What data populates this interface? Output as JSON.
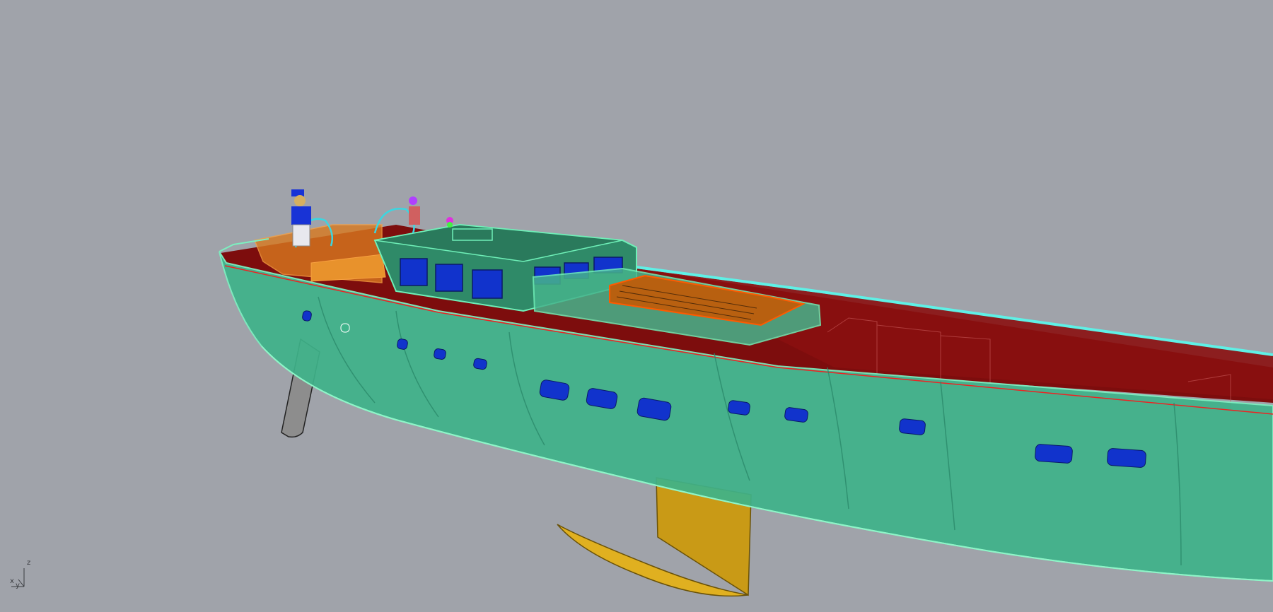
{
  "viewport": {
    "background_color": "#a0a3aa"
  },
  "colors": {
    "hull": "#3fb38a",
    "hull_edge": "#7cf0c0",
    "interior": "#7a0c0c",
    "deck_trim": "#5ff0e6",
    "cockpit": "#d9791f",
    "portholes": "#1133cc",
    "rudder": "#8a8a8a",
    "keel": "#d6a51a"
  },
  "axis_gizmo": {
    "z_label": "z",
    "x_label": "x",
    "y_label": "y"
  }
}
